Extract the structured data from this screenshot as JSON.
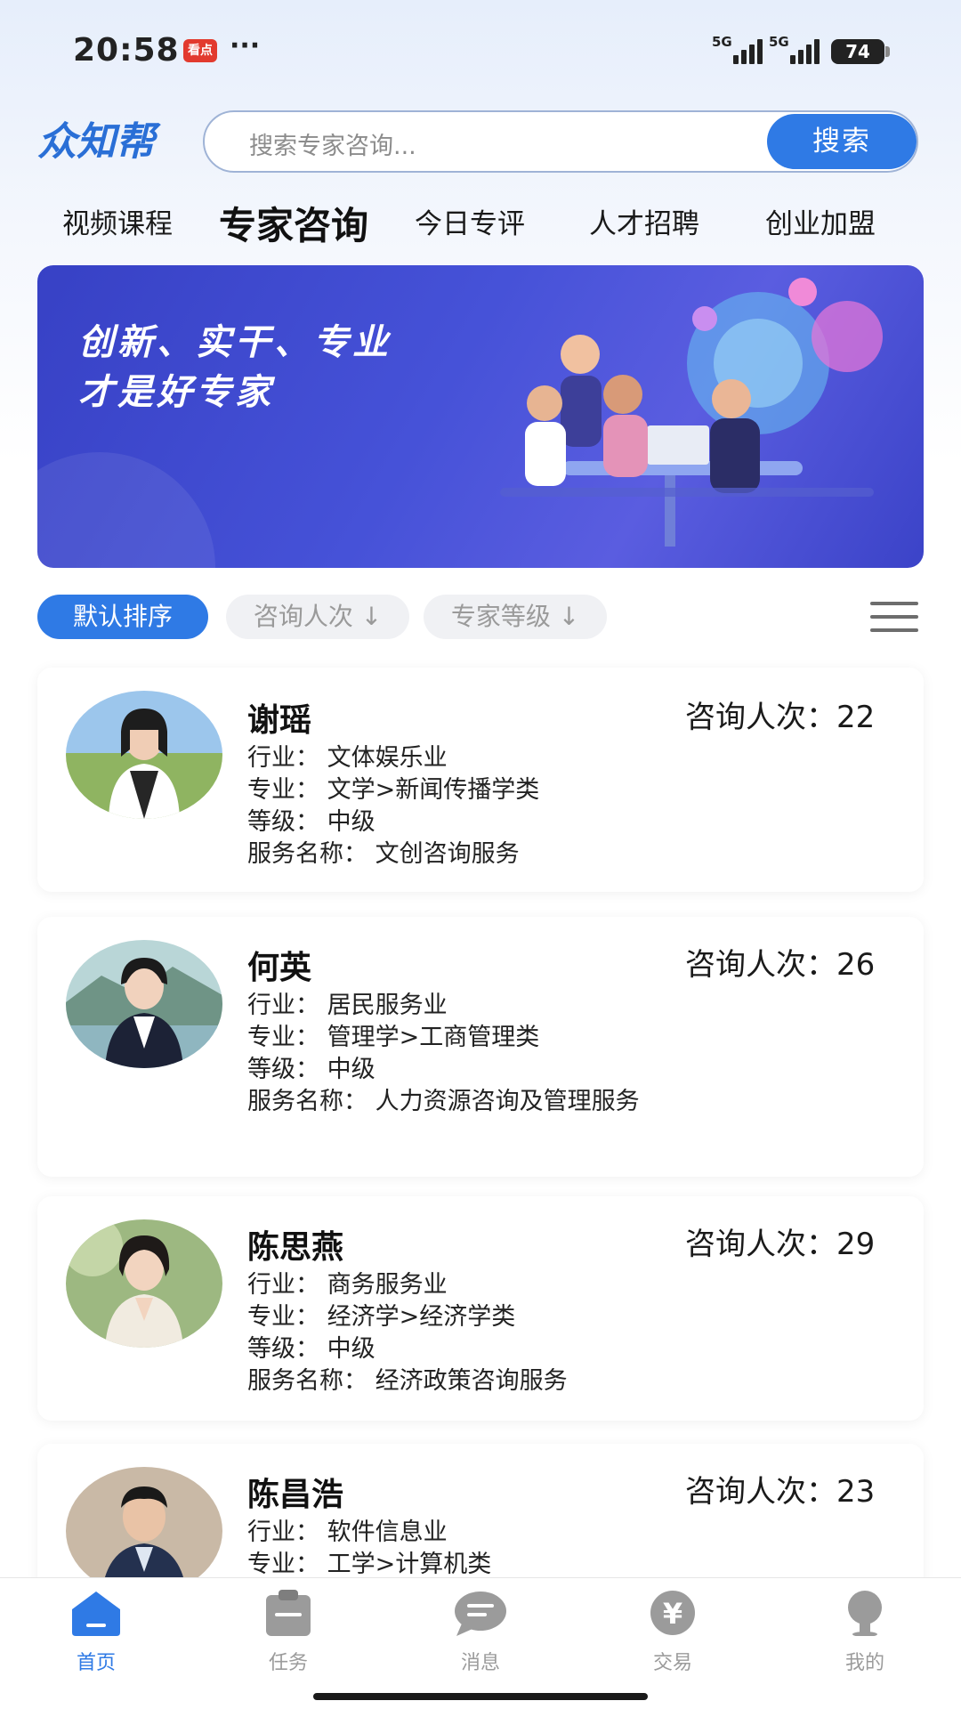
{
  "status_bar": {
    "time": "20:58",
    "app_badge": "看点",
    "more": "···",
    "signal_1": "5G",
    "signal_2": "5G",
    "battery": "74"
  },
  "header": {
    "logo_text": "众知帮",
    "search_placeholder": "搜索专家咨询...",
    "search_button": "搜索"
  },
  "tabs": [
    {
      "label": "视频课程",
      "active": false
    },
    {
      "label": "专家咨询",
      "active": true
    },
    {
      "label": "今日专评",
      "active": false
    },
    {
      "label": "人才招聘",
      "active": false
    },
    {
      "label": "创业加盟",
      "active": false
    }
  ],
  "banner": {
    "line1": "创新、实干、专业",
    "line2": "才是好专家"
  },
  "sort": {
    "default": "默认排序",
    "consult_count": "咨询人次 ↓",
    "expert_level": "专家等级 ↓"
  },
  "experts": [
    {
      "name": "谢瑶",
      "count_label": "咨询人次：",
      "count": "22",
      "industry": "行业：  文体娱乐业",
      "major": "专业：  文学>新闻传播学类",
      "level": "等级：  中级",
      "service": "服务名称：  文创咨询服务"
    },
    {
      "name": "何英",
      "count_label": "咨询人次：",
      "count": "26",
      "industry": "行业：  居民服务业",
      "major": "专业：  管理学>工商管理类",
      "level": "等级：  中级",
      "service": "服务名称：  人力资源咨询及管理服务"
    },
    {
      "name": "陈思燕",
      "count_label": "咨询人次：",
      "count": "29",
      "industry": "行业：  商务服务业",
      "major": "专业：  经济学>经济学类",
      "level": "等级：  中级",
      "service": "服务名称：  经济政策咨询服务"
    },
    {
      "name": "陈昌浩",
      "count_label": "咨询人次：",
      "count": "23",
      "industry": "行业：  软件信息业",
      "major": "专业：  工学>计算机类"
    }
  ],
  "bottom_nav": [
    {
      "label": "首页",
      "icon": "home-icon",
      "active": true
    },
    {
      "label": "任务",
      "icon": "clipboard-icon",
      "active": false
    },
    {
      "label": "消息",
      "icon": "chat-icon",
      "active": false
    },
    {
      "label": "交易",
      "icon": "yuan-icon",
      "active": false
    },
    {
      "label": "我的",
      "icon": "profile-icon",
      "active": false
    }
  ],
  "colors": {
    "accent": "#2f7ae5",
    "banner": "#4652d8",
    "nav_inactive": "#9b9b9b"
  }
}
